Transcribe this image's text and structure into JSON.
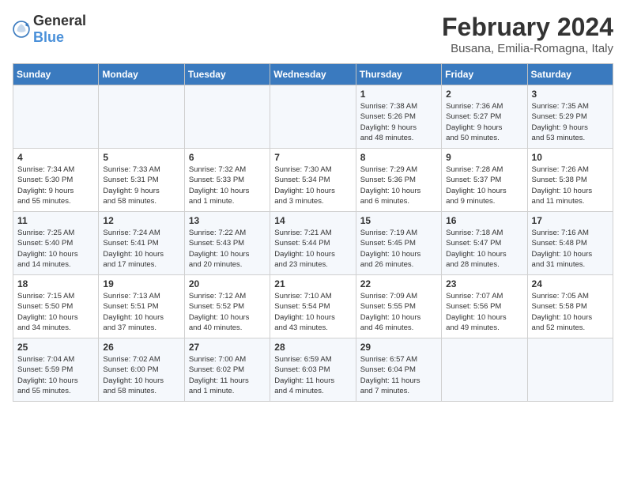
{
  "header": {
    "logo_general": "General",
    "logo_blue": "Blue",
    "main_title": "February 2024",
    "subtitle": "Busana, Emilia-Romagna, Italy"
  },
  "calendar": {
    "days_of_week": [
      "Sunday",
      "Monday",
      "Tuesday",
      "Wednesday",
      "Thursday",
      "Friday",
      "Saturday"
    ],
    "weeks": [
      [
        {
          "day": "",
          "info": ""
        },
        {
          "day": "",
          "info": ""
        },
        {
          "day": "",
          "info": ""
        },
        {
          "day": "",
          "info": ""
        },
        {
          "day": "1",
          "info": "Sunrise: 7:38 AM\nSunset: 5:26 PM\nDaylight: 9 hours\nand 48 minutes."
        },
        {
          "day": "2",
          "info": "Sunrise: 7:36 AM\nSunset: 5:27 PM\nDaylight: 9 hours\nand 50 minutes."
        },
        {
          "day": "3",
          "info": "Sunrise: 7:35 AM\nSunset: 5:29 PM\nDaylight: 9 hours\nand 53 minutes."
        }
      ],
      [
        {
          "day": "4",
          "info": "Sunrise: 7:34 AM\nSunset: 5:30 PM\nDaylight: 9 hours\nand 55 minutes."
        },
        {
          "day": "5",
          "info": "Sunrise: 7:33 AM\nSunset: 5:31 PM\nDaylight: 9 hours\nand 58 minutes."
        },
        {
          "day": "6",
          "info": "Sunrise: 7:32 AM\nSunset: 5:33 PM\nDaylight: 10 hours\nand 1 minute."
        },
        {
          "day": "7",
          "info": "Sunrise: 7:30 AM\nSunset: 5:34 PM\nDaylight: 10 hours\nand 3 minutes."
        },
        {
          "day": "8",
          "info": "Sunrise: 7:29 AM\nSunset: 5:36 PM\nDaylight: 10 hours\nand 6 minutes."
        },
        {
          "day": "9",
          "info": "Sunrise: 7:28 AM\nSunset: 5:37 PM\nDaylight: 10 hours\nand 9 minutes."
        },
        {
          "day": "10",
          "info": "Sunrise: 7:26 AM\nSunset: 5:38 PM\nDaylight: 10 hours\nand 11 minutes."
        }
      ],
      [
        {
          "day": "11",
          "info": "Sunrise: 7:25 AM\nSunset: 5:40 PM\nDaylight: 10 hours\nand 14 minutes."
        },
        {
          "day": "12",
          "info": "Sunrise: 7:24 AM\nSunset: 5:41 PM\nDaylight: 10 hours\nand 17 minutes."
        },
        {
          "day": "13",
          "info": "Sunrise: 7:22 AM\nSunset: 5:43 PM\nDaylight: 10 hours\nand 20 minutes."
        },
        {
          "day": "14",
          "info": "Sunrise: 7:21 AM\nSunset: 5:44 PM\nDaylight: 10 hours\nand 23 minutes."
        },
        {
          "day": "15",
          "info": "Sunrise: 7:19 AM\nSunset: 5:45 PM\nDaylight: 10 hours\nand 26 minutes."
        },
        {
          "day": "16",
          "info": "Sunrise: 7:18 AM\nSunset: 5:47 PM\nDaylight: 10 hours\nand 28 minutes."
        },
        {
          "day": "17",
          "info": "Sunrise: 7:16 AM\nSunset: 5:48 PM\nDaylight: 10 hours\nand 31 minutes."
        }
      ],
      [
        {
          "day": "18",
          "info": "Sunrise: 7:15 AM\nSunset: 5:50 PM\nDaylight: 10 hours\nand 34 minutes."
        },
        {
          "day": "19",
          "info": "Sunrise: 7:13 AM\nSunset: 5:51 PM\nDaylight: 10 hours\nand 37 minutes."
        },
        {
          "day": "20",
          "info": "Sunrise: 7:12 AM\nSunset: 5:52 PM\nDaylight: 10 hours\nand 40 minutes."
        },
        {
          "day": "21",
          "info": "Sunrise: 7:10 AM\nSunset: 5:54 PM\nDaylight: 10 hours\nand 43 minutes."
        },
        {
          "day": "22",
          "info": "Sunrise: 7:09 AM\nSunset: 5:55 PM\nDaylight: 10 hours\nand 46 minutes."
        },
        {
          "day": "23",
          "info": "Sunrise: 7:07 AM\nSunset: 5:56 PM\nDaylight: 10 hours\nand 49 minutes."
        },
        {
          "day": "24",
          "info": "Sunrise: 7:05 AM\nSunset: 5:58 PM\nDaylight: 10 hours\nand 52 minutes."
        }
      ],
      [
        {
          "day": "25",
          "info": "Sunrise: 7:04 AM\nSunset: 5:59 PM\nDaylight: 10 hours\nand 55 minutes."
        },
        {
          "day": "26",
          "info": "Sunrise: 7:02 AM\nSunset: 6:00 PM\nDaylight: 10 hours\nand 58 minutes."
        },
        {
          "day": "27",
          "info": "Sunrise: 7:00 AM\nSunset: 6:02 PM\nDaylight: 11 hours\nand 1 minute."
        },
        {
          "day": "28",
          "info": "Sunrise: 6:59 AM\nSunset: 6:03 PM\nDaylight: 11 hours\nand 4 minutes."
        },
        {
          "day": "29",
          "info": "Sunrise: 6:57 AM\nSunset: 6:04 PM\nDaylight: 11 hours\nand 7 minutes."
        },
        {
          "day": "",
          "info": ""
        },
        {
          "day": "",
          "info": ""
        }
      ]
    ]
  }
}
